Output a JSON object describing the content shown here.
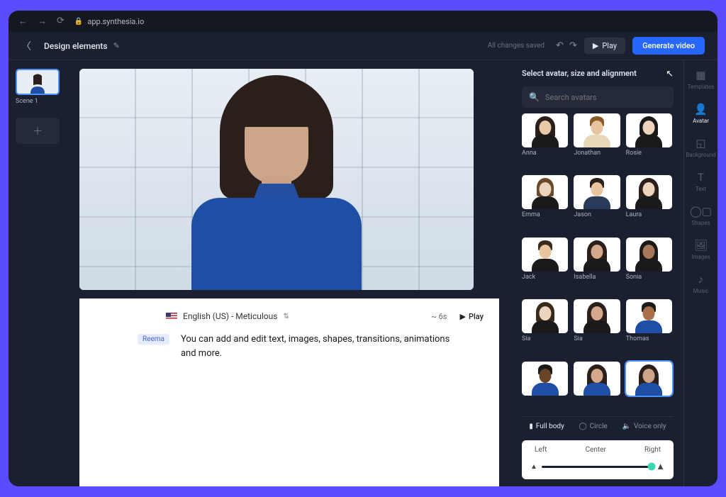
{
  "browser": {
    "url": "app.synthesia.io"
  },
  "header": {
    "title": "Design elements",
    "saved_text": "All changes saved",
    "play_label": "Play",
    "generate_label": "Generate video"
  },
  "scenes": {
    "first_label": "Scene 1"
  },
  "script": {
    "language": "English (US) - Meticulous",
    "duration": "~ 6s",
    "play_link": "Play",
    "speaker": "Reema",
    "text": "You can add and edit text, images, shapes, transitions, animations and more."
  },
  "avatar_panel": {
    "title": "Select avatar, size and alignment",
    "search_placeholder": "Search avatars",
    "avatars": [
      {
        "name": "Anna",
        "skin": "#e8c9a8",
        "hair": "#2a1f1a",
        "hairW": 28,
        "hairH": 30,
        "shirt": "#1a1a1a"
      },
      {
        "name": "Jonathan",
        "skin": "#e8c4a0",
        "hair": "#8a5a2a",
        "hairW": 20,
        "hairH": 14,
        "shirt": "#e8d8b8"
      },
      {
        "name": "Rosie",
        "skin": "#ecd4be",
        "hair": "#1a1a1a",
        "hairW": 26,
        "hairH": 28,
        "shirt": "#1a1a1a"
      },
      {
        "name": "Emma",
        "skin": "#ecd4be",
        "hair": "#6a4a2a",
        "hairW": 24,
        "hairH": 26,
        "shirt": "#1a1a1a"
      },
      {
        "name": "Jason",
        "skin": "#e8c4a0",
        "hair": "#2a1f1a",
        "hairW": 20,
        "hairH": 14,
        "shirt": "#2a3a5a"
      },
      {
        "name": "Laura",
        "skin": "#ecd4be",
        "hair": "#2a1f1a",
        "hairW": 28,
        "hairH": 32,
        "shirt": "#1a1a1a"
      },
      {
        "name": "Jack",
        "skin": "#e8c4a0",
        "hair": "#3a2a1a",
        "hairW": 20,
        "hairH": 14,
        "shirt": "#1a1a1a"
      },
      {
        "name": "Isabella",
        "skin": "#d4a888",
        "hair": "#2a1f1a",
        "hairW": 28,
        "hairH": 32,
        "shirt": "#1a1a1a"
      },
      {
        "name": "Sonia",
        "skin": "#a8785a",
        "hair": "#1a1a1a",
        "hairW": 26,
        "hairH": 30,
        "shirt": "#1a1a1a"
      },
      {
        "name": "Sia",
        "skin": "#ecd4be",
        "hair": "#3a2a1a",
        "hairW": 26,
        "hairH": 28,
        "shirt": "#1a1a1a"
      },
      {
        "name": "Sia",
        "skin": "#d4a888",
        "hair": "#2a1f1a",
        "hairW": 28,
        "hairH": 32,
        "shirt": "#1a1a1a"
      },
      {
        "name": "Thomas",
        "skin": "#a8704a",
        "hair": "#1a1a1a",
        "hairW": 20,
        "hairH": 14,
        "shirt": "#1f4fa5"
      },
      {
        "name": "",
        "skin": "#6a4428",
        "hair": "#1a1a1a",
        "hairW": 20,
        "hairH": 14,
        "shirt": "#1f4fa5"
      },
      {
        "name": "",
        "skin": "#d4a888",
        "hair": "#2a1f1a",
        "hairW": 28,
        "hairH": 32,
        "shirt": "#1f4fa5"
      },
      {
        "name": "",
        "skin": "#cda68a",
        "hair": "#2a1f1a",
        "hairW": 28,
        "hairH": 34,
        "shirt": "#1f4fa5",
        "selected": true
      }
    ],
    "view_tabs": {
      "full_body": "Full body",
      "circle": "Circle",
      "voice_only": "Voice only"
    },
    "alignment": {
      "left": "Left",
      "center": "Center",
      "right": "Right"
    }
  },
  "tool_rail": {
    "items": [
      {
        "label": "Templates",
        "icon": "▦"
      },
      {
        "label": "Avatar",
        "icon": "👤",
        "active": true
      },
      {
        "label": "Background",
        "icon": "◱"
      },
      {
        "label": "Text",
        "icon": "T"
      },
      {
        "label": "Shapes",
        "icon": "◯▢"
      },
      {
        "label": "Images",
        "icon": "🖼"
      },
      {
        "label": "Music",
        "icon": "♪"
      }
    ]
  }
}
